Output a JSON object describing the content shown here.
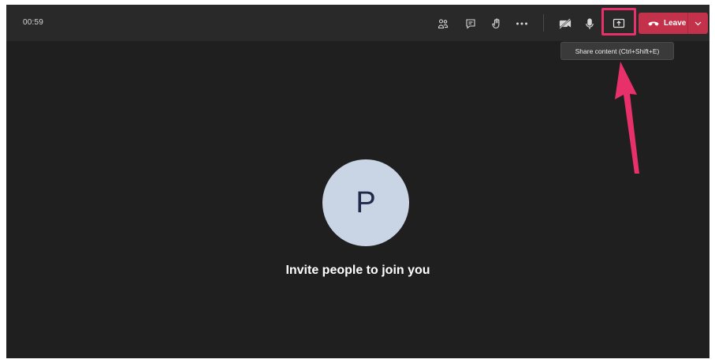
{
  "meeting": {
    "timer": "00:59",
    "avatar_initial": "P",
    "invite_text": "Invite people to join you"
  },
  "toolbar": {
    "buttons": [
      {
        "name": "participants",
        "icon": "people-icon"
      },
      {
        "name": "chat",
        "icon": "chat-icon"
      },
      {
        "name": "raise-hand",
        "icon": "hand-icon"
      },
      {
        "name": "more-actions",
        "icon": "more-icon"
      },
      {
        "name": "camera",
        "icon": "camera-off-icon"
      },
      {
        "name": "microphone",
        "icon": "microphone-icon"
      },
      {
        "name": "share",
        "icon": "share-screen-icon"
      }
    ],
    "leave_label": "Leave",
    "share_tooltip": "Share content (Ctrl+Shift+E)"
  },
  "colors": {
    "background": "#1f1f1f",
    "topbar": "#292929",
    "leave": "#c4314b",
    "highlight": "#e8306b",
    "avatar": "#c9d4e4"
  }
}
